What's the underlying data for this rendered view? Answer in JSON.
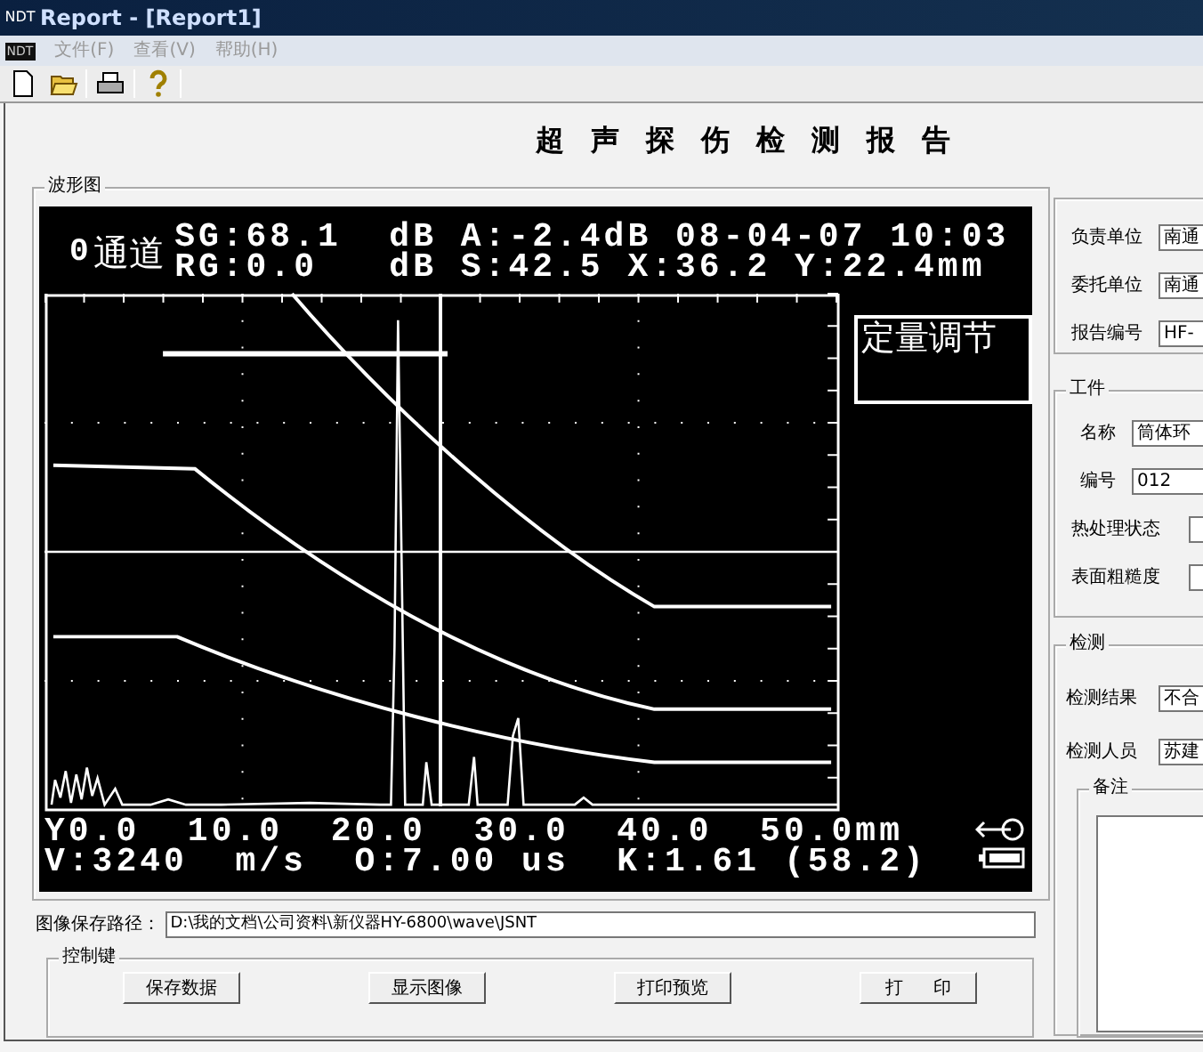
{
  "window": {
    "title": "Report - [Report1]",
    "app_icon": "NDT"
  },
  "menu": {
    "icon": "NDT",
    "items": [
      "文件(F)",
      "查看(V)",
      "帮助(H)"
    ]
  },
  "report_title": "超声探伤检测报告",
  "waveform": {
    "legend": "波形图",
    "channel": "0",
    "channel_label": "通道",
    "status_lines": [
      "SG:68.1  dB A:-2.4dB 08-04-07 10:03",
      "RG:0.0   dB S:42.5 X:36.2 Y:22.4mm"
    ],
    "mode_box": "定量调节",
    "axis_line": "Y0.0  10.0  20.0  30.0  40.0  50.0mm",
    "info_line": "V:3240  m/s  O:7.00 us  K:1.61 (58.2)"
  },
  "save_path": {
    "label": "图像保存路径：",
    "value": "D:\\我的文档\\公司资料\\新仪器HY-6800\\wave\\JSNT"
  },
  "controls": {
    "legend": "控制键",
    "buttons": [
      "保存数据",
      "显示图像",
      "打印预览",
      "打 印"
    ]
  },
  "report_info": [
    {
      "label": "负责单位",
      "value": "南通"
    },
    {
      "label": "委托单位",
      "value": "南通"
    },
    {
      "label": "报告编号",
      "value": "HF-"
    }
  ],
  "workpiece": {
    "legend": "工件",
    "fields": [
      {
        "label": "名称",
        "value": "筒体环"
      },
      {
        "label": "编号",
        "value": "012"
      },
      {
        "label": "热处理状态"
      },
      {
        "label": "表面粗糙度"
      }
    ]
  },
  "inspection": {
    "legend": "检测",
    "fields": [
      {
        "label": "检测结果",
        "value": "不合"
      },
      {
        "label": "检测人员",
        "value": "苏建"
      }
    ],
    "remarks_legend": "备注"
  }
}
